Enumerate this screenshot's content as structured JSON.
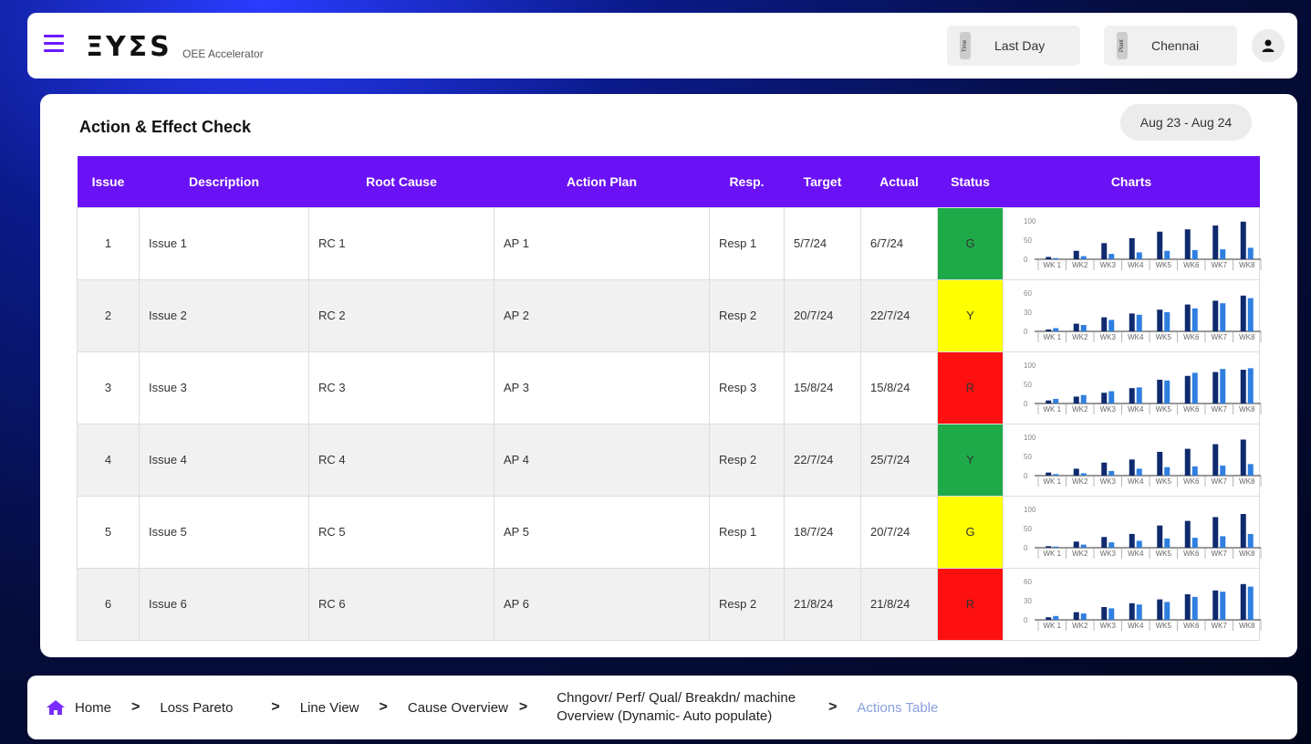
{
  "header": {
    "brand": "ΞΥΣS",
    "subtitle": "OEE Accelerator",
    "time_tag": "Time",
    "time_value": "Last Day",
    "plant_tag": "Plant",
    "plant_value": "Chennai"
  },
  "card": {
    "title": "Action & Effect Check",
    "date_range": "Aug 23 - Aug 24"
  },
  "table": {
    "columns": [
      "Issue",
      "Description",
      "Root Cause",
      "Action Plan",
      "Resp.",
      "Target",
      "Actual",
      "Status",
      "Charts"
    ],
    "rows": [
      {
        "issue": "1",
        "description": "Issue 1",
        "root_cause": "RC 1",
        "action_plan": "AP 1",
        "resp": "Resp 1",
        "target": "5/7/24",
        "actual": "6/7/24",
        "status": "G",
        "status_color": "#1faa4a"
      },
      {
        "issue": "2",
        "description": "Issue 2",
        "root_cause": "RC 2",
        "action_plan": "AP 2",
        "resp": "Resp 2",
        "target": "20/7/24",
        "actual": "22/7/24",
        "status": "Y",
        "status_color": "#ffff00"
      },
      {
        "issue": "3",
        "description": "Issue 3",
        "root_cause": "RC 3",
        "action_plan": "AP 3",
        "resp": "Resp 3",
        "target": "15/8/24",
        "actual": "15/8/24",
        "status": "R",
        "status_color": "#ff1010"
      },
      {
        "issue": "4",
        "description": "Issue 4",
        "root_cause": "RC 4",
        "action_plan": "AP 4",
        "resp": "Resp 2",
        "target": "22/7/24",
        "actual": "25/7/24",
        "status": "Y",
        "status_color": "#1faa4a"
      },
      {
        "issue": "5",
        "description": "Issue 5",
        "root_cause": "RC 5",
        "action_plan": "AP 5",
        "resp": "Resp 1",
        "target": "18/7/24",
        "actual": "20/7/24",
        "status": "G",
        "status_color": "#ffff00"
      },
      {
        "issue": "6",
        "description": "Issue 6",
        "root_cause": "RC 6",
        "action_plan": "AP 6",
        "resp": "Resp 2",
        "target": "21/8/24",
        "actual": "21/8/24",
        "status": "R",
        "status_color": "#ff1010"
      }
    ]
  },
  "breadcrumb": {
    "home": "Home",
    "loss_pareto": "Loss Pareto",
    "line_view": "Line View",
    "cause_overview": "Cause Overview",
    "chngovr_line1": "Chngovr/ Perf/ Qual/ Breakdn/ machine",
    "chngovr_line2": "Overview (Dynamic- Auto populate)",
    "actions_table": "Actions Table"
  },
  "colors": {
    "accent": "#6a11f5",
    "dark_bar": "#0f2a6e",
    "light_bar": "#2f7fe0"
  },
  "chart_data": [
    {
      "type": "bar",
      "categories": [
        "WK 1",
        "WK2",
        "WK3",
        "WK4",
        "WK5",
        "WK6",
        "WK7",
        "WK8"
      ],
      "ylim": [
        0,
        100
      ],
      "yticks": [
        "100",
        "50",
        "0"
      ],
      "series": [
        {
          "values": [
            6,
            22,
            42,
            55,
            72,
            78,
            88,
            98
          ]
        },
        {
          "values": [
            3,
            8,
            14,
            18,
            22,
            24,
            26,
            30
          ]
        }
      ]
    },
    {
      "type": "bar",
      "categories": [
        "WK 1",
        "WK2",
        "WK3",
        "WK4",
        "WK5",
        "WK6",
        "WK7",
        "WK8"
      ],
      "ylim": [
        0,
        60
      ],
      "yticks": [
        "60",
        "30",
        "0"
      ],
      "series": [
        {
          "values": [
            3,
            12,
            22,
            28,
            34,
            42,
            48,
            56
          ]
        },
        {
          "values": [
            5,
            10,
            18,
            26,
            30,
            36,
            44,
            52
          ]
        }
      ]
    },
    {
      "type": "bar",
      "categories": [
        "WK 1",
        "WK2",
        "WK3",
        "WK4",
        "WK5",
        "WK6",
        "WK7",
        "WK8"
      ],
      "ylim": [
        0,
        100
      ],
      "yticks": [
        "100",
        "50",
        "0"
      ],
      "series": [
        {
          "values": [
            8,
            18,
            28,
            40,
            62,
            72,
            82,
            88
          ]
        },
        {
          "values": [
            12,
            22,
            32,
            42,
            60,
            80,
            90,
            92
          ]
        }
      ]
    },
    {
      "type": "bar",
      "categories": [
        "WK 1",
        "WK2",
        "WK3",
        "WK4",
        "WK5",
        "WK6",
        "WK7",
        "WK8"
      ],
      "ylim": [
        0,
        100
      ],
      "yticks": [
        "100",
        "50",
        "0"
      ],
      "series": [
        {
          "values": [
            8,
            18,
            34,
            42,
            62,
            70,
            82,
            94
          ]
        },
        {
          "values": [
            4,
            6,
            12,
            18,
            22,
            24,
            26,
            30
          ]
        }
      ]
    },
    {
      "type": "bar",
      "categories": [
        "WK 1",
        "WK2",
        "WK3",
        "WK4",
        "WK5",
        "WK6",
        "WK7",
        "WK8"
      ],
      "ylim": [
        0,
        100
      ],
      "yticks": [
        "100",
        "50",
        "0"
      ],
      "series": [
        {
          "values": [
            4,
            16,
            28,
            36,
            58,
            70,
            80,
            88
          ]
        },
        {
          "values": [
            3,
            8,
            14,
            18,
            24,
            26,
            30,
            36
          ]
        }
      ]
    },
    {
      "type": "bar",
      "categories": [
        "WK 1",
        "WK2",
        "WK3",
        "WK4",
        "WK5",
        "WK6",
        "WK7",
        "WK8"
      ],
      "ylim": [
        0,
        60
      ],
      "yticks": [
        "60",
        "30",
        "0"
      ],
      "series": [
        {
          "values": [
            4,
            12,
            20,
            26,
            32,
            40,
            46,
            56
          ]
        },
        {
          "values": [
            6,
            10,
            18,
            24,
            28,
            36,
            44,
            52
          ]
        }
      ]
    }
  ]
}
